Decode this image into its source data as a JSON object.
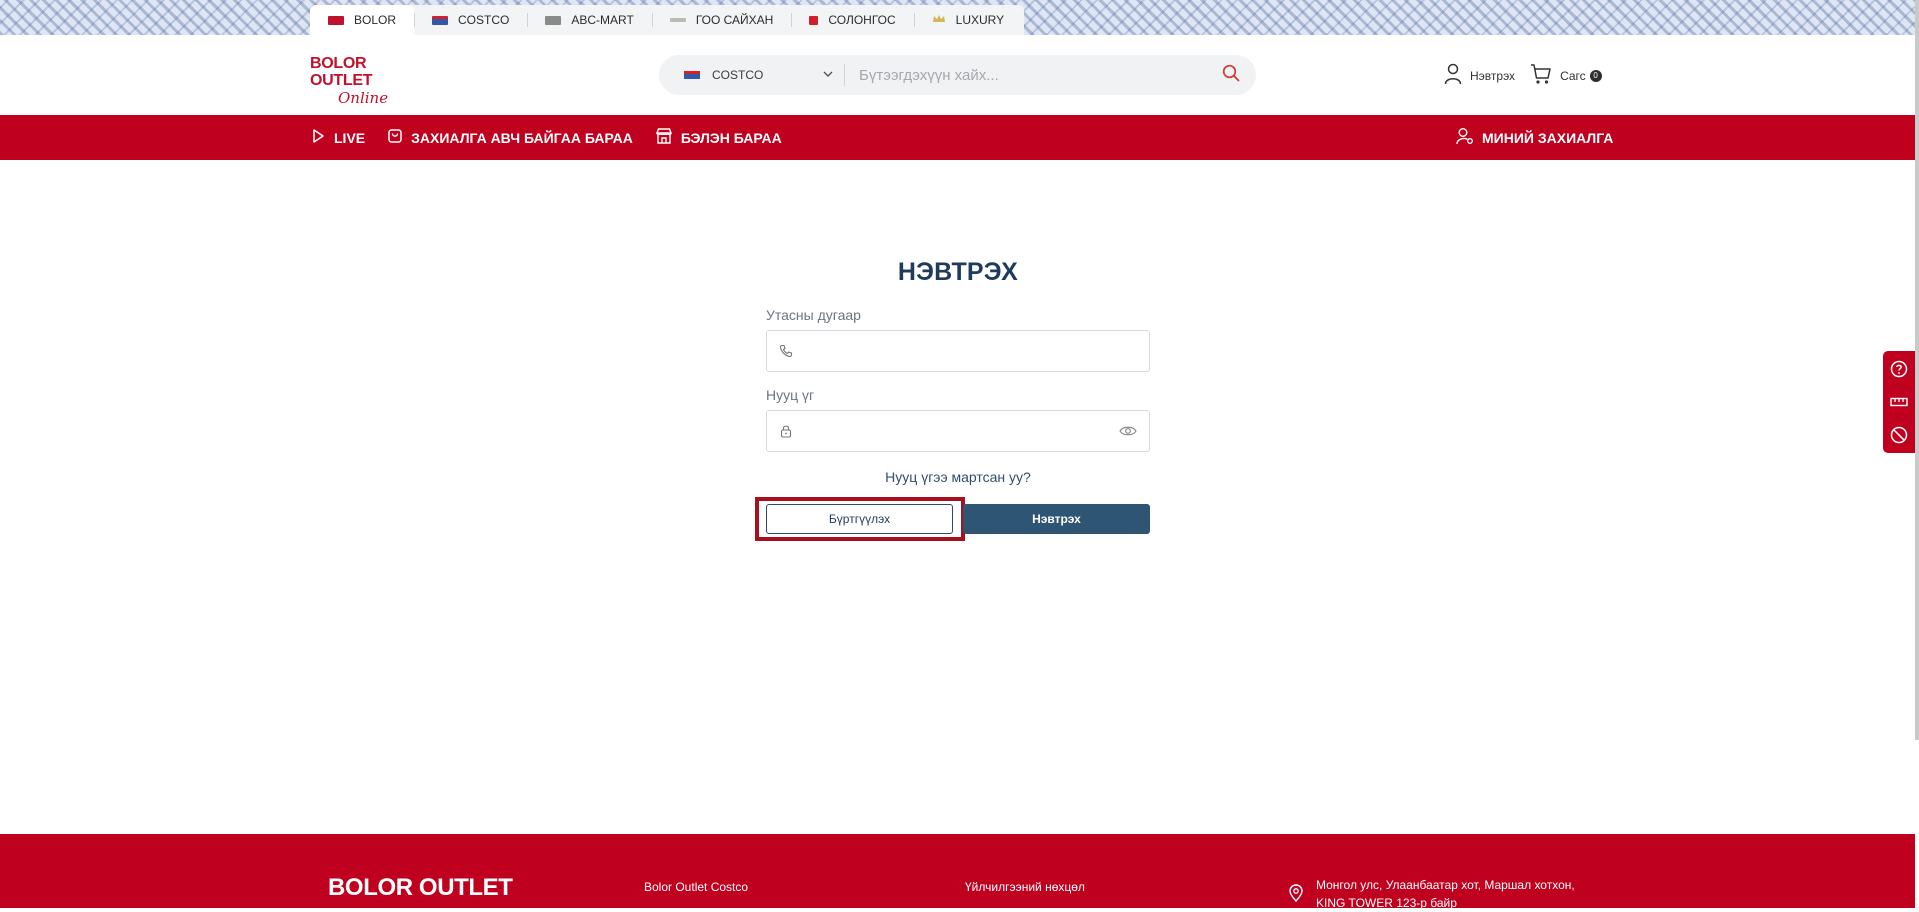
{
  "store_tabs": [
    {
      "label": "BOLOR",
      "active": true,
      "color": "#c0122c"
    },
    {
      "label": "COSTCO",
      "active": false,
      "color": "#3558a6"
    },
    {
      "label": "ABC-MART",
      "active": false,
      "color": "#7a7a7a"
    },
    {
      "label": "ГОО САЙХАН",
      "active": false,
      "color": "#9aa39a"
    },
    {
      "label": "СОЛОНГОС",
      "active": false,
      "color": "#d2202a"
    },
    {
      "label": "LUXURY",
      "active": false,
      "color": "#c7a24b"
    }
  ],
  "brand": {
    "line1": "BOLOR OUTLET",
    "line2": "Online"
  },
  "search": {
    "store": "COSTCO",
    "placeholder": "Бүтээгдэхүүн хайх..."
  },
  "header": {
    "login": "Нэвтрэх",
    "cart": "Сагс",
    "cart_count": "0"
  },
  "nav": {
    "items": [
      {
        "label": "LIVE",
        "icon": "play-icon"
      },
      {
        "label": "ЗАХИАЛГА АВЧ БАЙГАА БАРАА",
        "icon": "bag-icon"
      },
      {
        "label": "БЭЛЭН БАРАА",
        "icon": "store-icon"
      }
    ],
    "my_orders": "МИНИЙ ЗАХИАЛГА"
  },
  "login": {
    "title": "НЭВТРЭХ",
    "phone_label": "Утасны дугаар",
    "phone_value": "",
    "password_label": "Нууц үг",
    "password_value": "",
    "forgot": "Нууц үгээ мартсан уу?",
    "register_button": "Бүртгүүлэх",
    "login_button": "Нэвтрэх"
  },
  "side_tools": [
    "help-icon",
    "ruler-icon",
    "block-icon"
  ],
  "footer": {
    "brand": "BOLOR OUTLET",
    "link1": "Bolor Outlet Costco",
    "link2": "Үйлчилгээний нөхцөл",
    "address_line1": "Монгол улс, Улаанбаатар хот, Маршал хотхон,",
    "address_line2": "KING TOWER 123-р байр"
  },
  "colors": {
    "brand_red": "#c0001f",
    "navy": "#2e5574",
    "title": "#1f3b5c"
  }
}
